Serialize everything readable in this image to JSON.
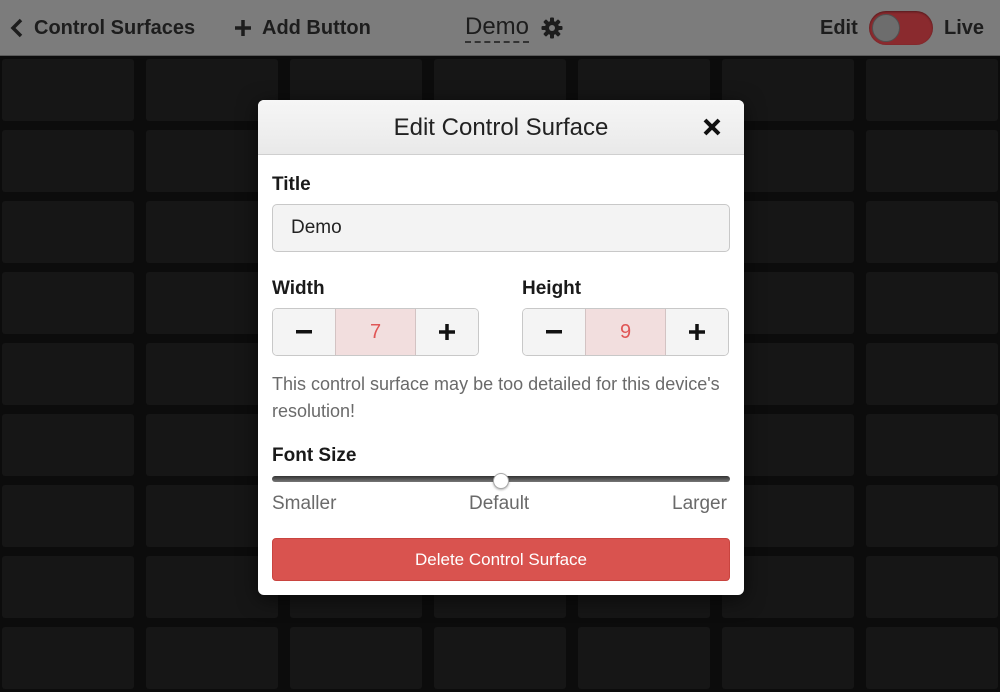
{
  "topbar": {
    "back_label": "Control Surfaces",
    "add_label": "Add Button",
    "surface_title": "Demo",
    "edit_label": "Edit",
    "live_label": "Live"
  },
  "modal": {
    "title": "Edit Control Surface",
    "title_label": "Title",
    "title_value": "Demo",
    "width_label": "Width",
    "width_value": "7",
    "height_label": "Height",
    "height_value": "9",
    "warning": "This control surface may be too detailed for this device's resolution!",
    "font_size_label": "Font Size",
    "font_size_level": 0.5,
    "slider_labels": {
      "smaller": "Smaller",
      "default": "Default",
      "larger": "Larger"
    },
    "delete_label": "Delete Control Surface"
  },
  "colors": {
    "delete": "#d9534f",
    "stepper_value_bg": "#f2dede",
    "stepper_value_text": "#e05555",
    "toggle_bg": "#8a2a2e"
  }
}
